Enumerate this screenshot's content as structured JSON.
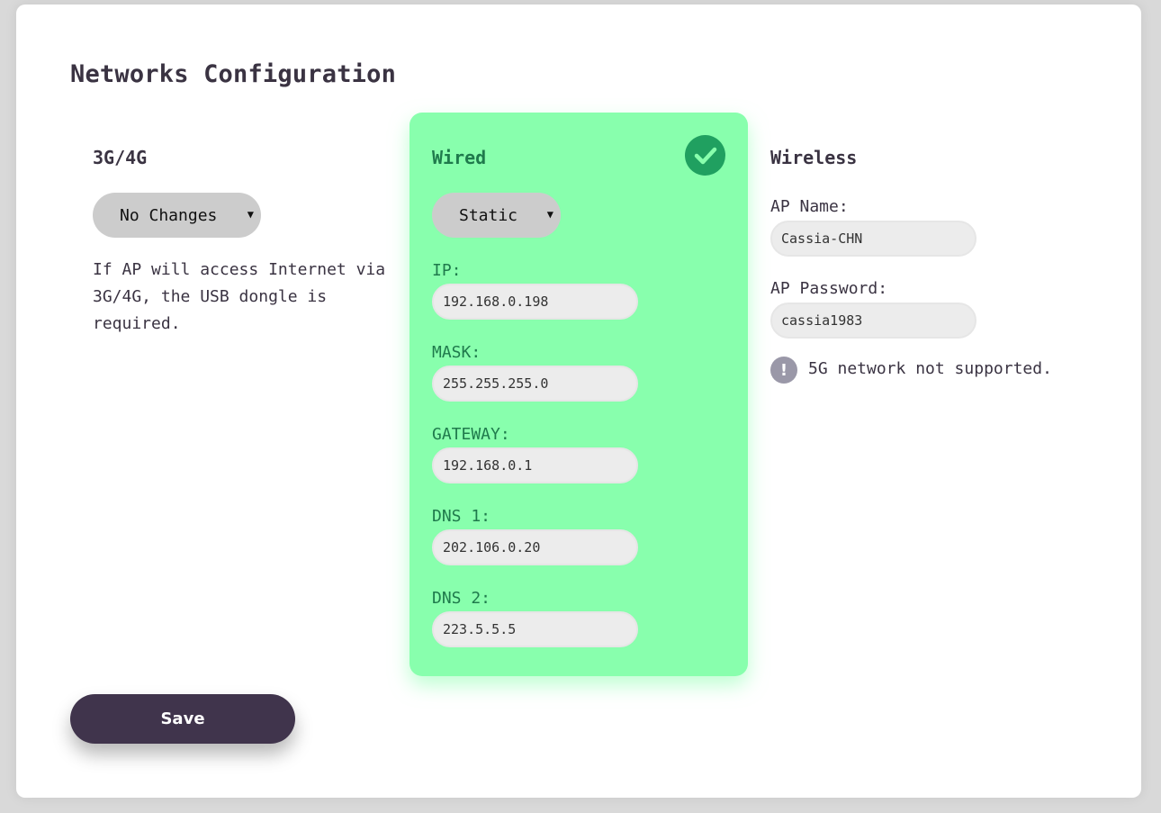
{
  "page": {
    "title": "Networks Configuration"
  },
  "cellular": {
    "heading": "3G/4G",
    "mode": "No Changes",
    "help": "If AP will access Internet via 3G/4G, the USB dongle is required."
  },
  "wired": {
    "heading": "Wired",
    "status_icon": "check-circle-icon",
    "mode": "Static",
    "fields": [
      {
        "label": "IP:",
        "value": "192.168.0.198"
      },
      {
        "label": "MASK:",
        "value": "255.255.255.0"
      },
      {
        "label": "GATEWAY:",
        "value": "192.168.0.1"
      },
      {
        "label": "DNS 1:",
        "value": "202.106.0.20"
      },
      {
        "label": "DNS 2:",
        "value": "223.5.5.5"
      }
    ]
  },
  "wireless": {
    "heading": "Wireless",
    "ap_name_label": "AP Name:",
    "ap_name_value": "Cassia-CHN",
    "ap_password_label": "AP Password:",
    "ap_password_value": "cassia1983",
    "notice_icon": "exclamation-circle-icon",
    "notice": "5G network not supported."
  },
  "actions": {
    "save_label": "Save"
  },
  "colors": {
    "accent_active": "#88ffad",
    "accent_check": "#20a060",
    "primary_button": "#40344c",
    "text": "#3a3342"
  }
}
